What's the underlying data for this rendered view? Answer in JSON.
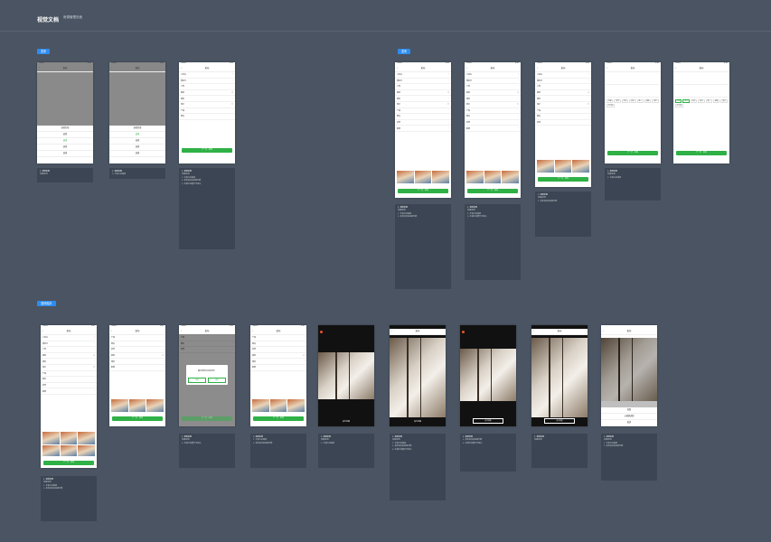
{
  "header": {
    "title": "视觉文档",
    "subtitle": "房源管理页面",
    "subtitle2": "",
    "tabs": [
      "",
      "",
      ""
    ]
  },
  "sections": [
    {
      "tag": "发布"
    },
    {
      "tag": "发布"
    },
    {
      "tag": "选择图片"
    }
  ],
  "frames": {
    "nav_title": "发布",
    "publish_button": "下一步 · 发布",
    "rows": [
      "小区名",
      "楼栋号",
      "户型",
      "面积",
      "楼层",
      "售价",
      "产权",
      "朝向",
      "装修",
      "配套"
    ],
    "picker": [
      "选择区域",
      "选择",
      "选择",
      "选择",
      "选择"
    ],
    "tags": [
      "电梯",
      "地铁",
      "学区",
      "满五",
      "唯一",
      "精装",
      "南北",
      "近公园"
    ],
    "dialog_text": "确定放弃本次发布吗？",
    "dialog_cancel": "取消",
    "dialog_ok": "确定",
    "photo_caption": "设为封面",
    "sheet_items": [
      "拍照",
      "从相册选择",
      "取消"
    ]
  },
  "notes": {
    "heading": "1. 规则说明",
    "lines": [
      "页面说明：",
      "1. 字段为必填项",
      "2. 发布成功后返回列表",
      "3. 未填写完整不可提交"
    ]
  }
}
